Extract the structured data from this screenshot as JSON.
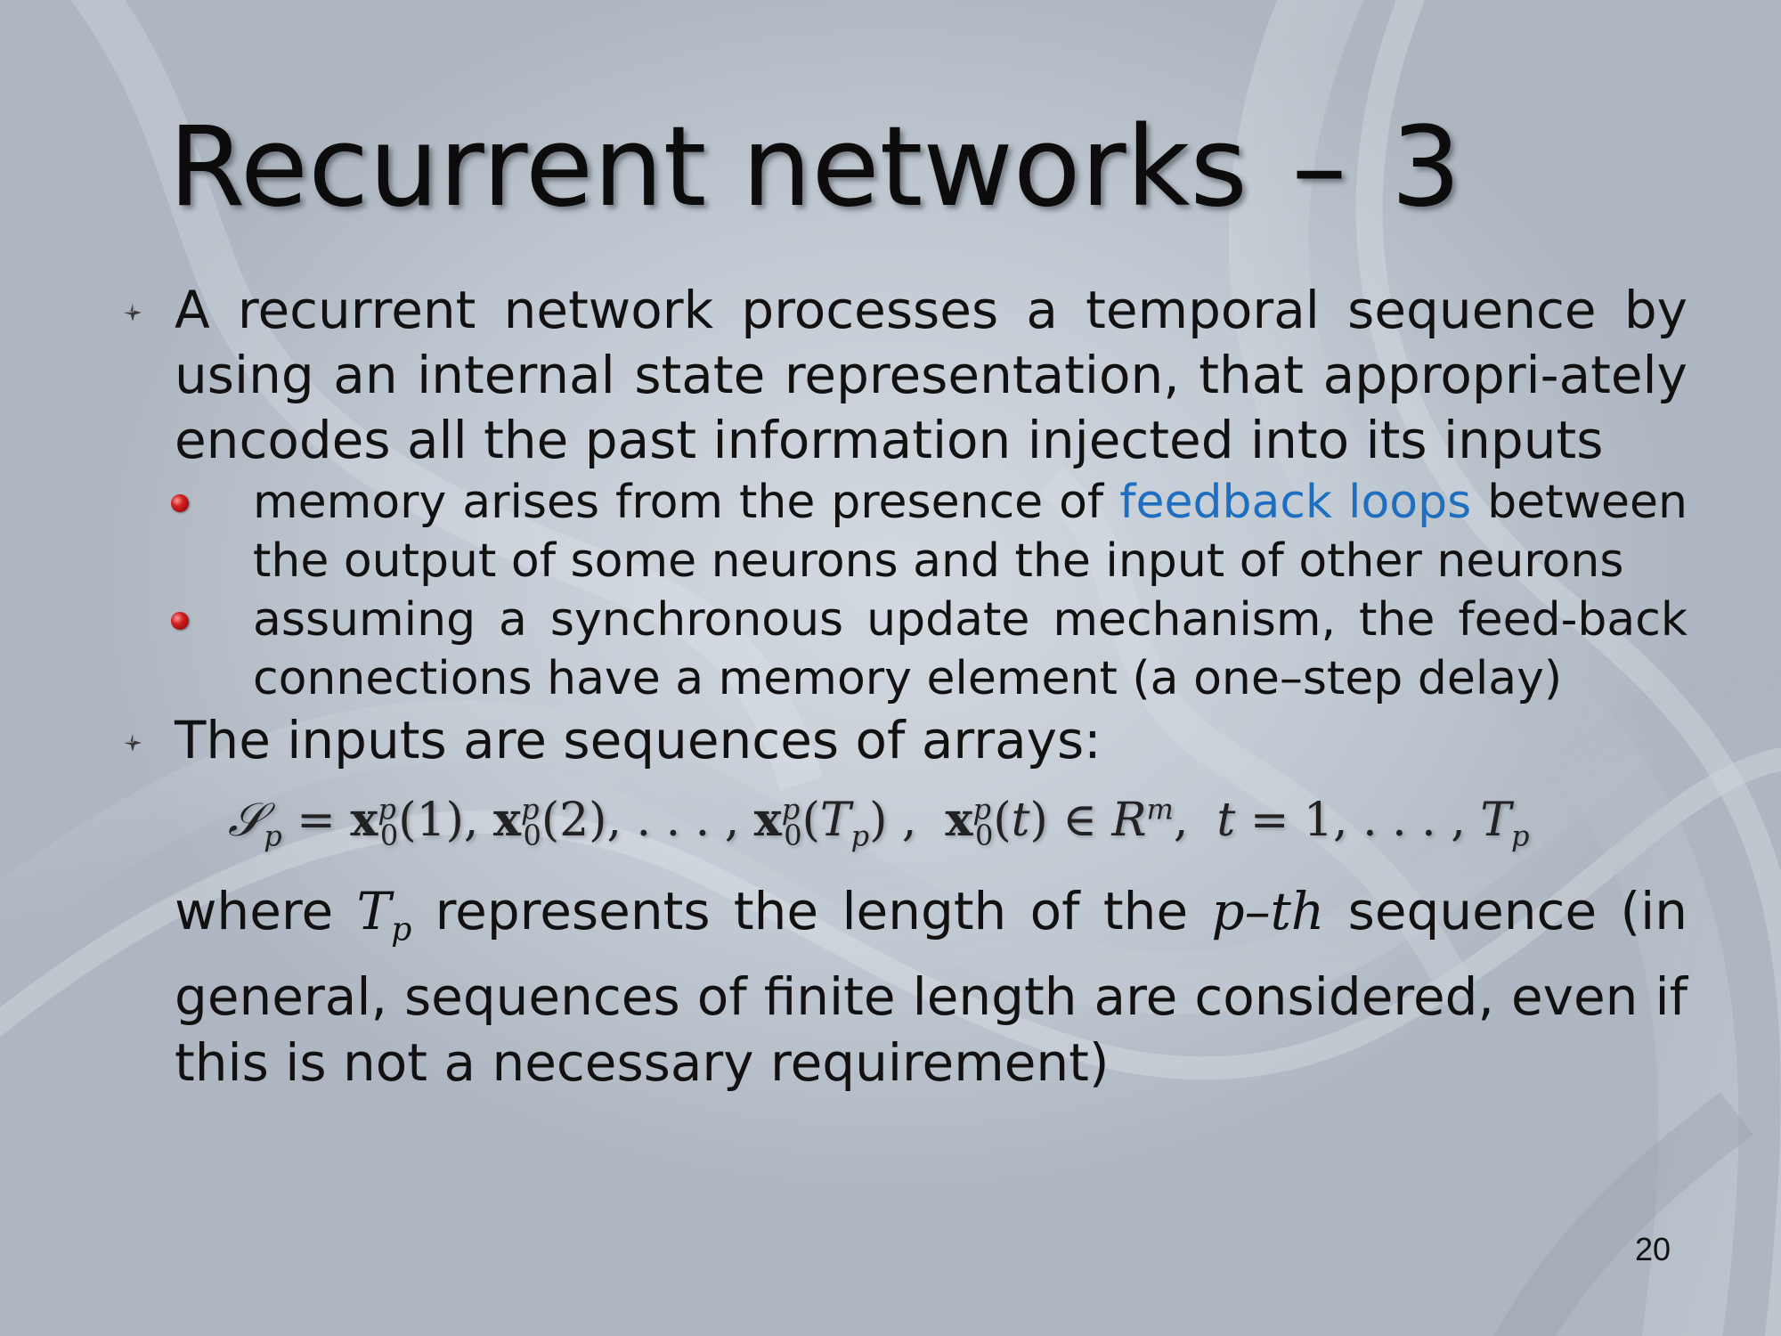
{
  "slide": {
    "title_main": "Recurrent networks",
    "title_dash": "–",
    "title_num": "3",
    "bullet1": {
      "text": "A recurrent network processes a temporal sequence by using an internal state representation, that appropri-ately encodes all the past information injected into its inputs",
      "sub1_before": "memory arises from the presence of ",
      "sub1_link": "feedback loops",
      "sub1_after": " between the output of some neurons and the input of other neurons",
      "sub2": "assuming a synchronous update mechanism, the feed-back connections have a memory element (a one–step delay)"
    },
    "bullet2": {
      "text": "The inputs are sequences of arrays:"
    },
    "formula": {
      "part1": "𝒮",
      "sub_p": "p",
      "eq": " = ",
      "x": "x",
      "sup_p": "p",
      "sub_0": "0",
      "arg1": "(1), ",
      "arg2": "(2), . . . , ",
      "arg3_open": "(",
      "T": "T",
      "arg3_close": ") ,",
      "arg4": "(",
      "t": "t",
      "arg4_close": ") ∈ ",
      "R": "R",
      "sup_m": "m",
      "comma": ",",
      "t_eq": " = 1, . . . , ",
      "T_end": "T"
    },
    "para": {
      "where": "where ",
      "T": "T",
      "T_sub": "p",
      "after_T": " represents the length of the ",
      "p_th": "p–th",
      "rest": " sequence (in general, sequences of finite length are considered, even if this is not a necessary requirement)"
    },
    "page_number": "20"
  },
  "colors": {
    "link": "#1f6fc0",
    "background": "#c2cad3",
    "bullet_red": "#d42222"
  },
  "icons": {
    "bullet_level1": "four-point-star-bullet-icon",
    "bullet_level2": "red-sphere-bullet-icon"
  }
}
